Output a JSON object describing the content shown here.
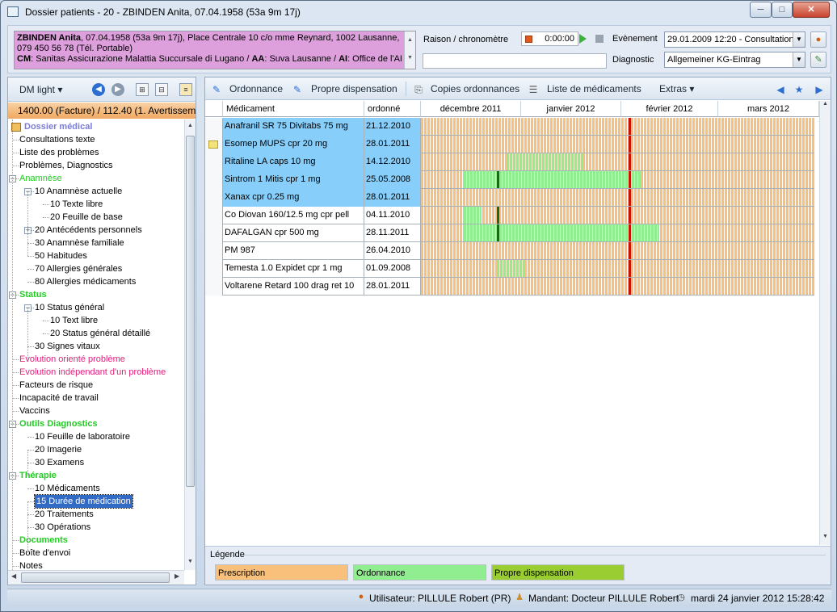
{
  "window": {
    "title": "Dossier patients - 20 - ZBINDEN Anita, 07.04.1958 (53a 9m 17j)",
    "min_glyph": "─",
    "max_glyph": "□",
    "close_glyph": "✕"
  },
  "patient": {
    "name": "ZBINDEN Anita",
    "details": ", 07.04.1958 (53a 9m 17j), Place Centrale 10 c/o mme Reynard, 1002 Lausanne, 079 450 56 78 (Tél. Portable)",
    "cm_label": "CM",
    "cm_value": ": Sanitas Assicurazione Malattia Succursale di Lugano / ",
    "aa_label": "AA",
    "aa_value": ": Suva Lausanne / ",
    "ai_label": "AI",
    "ai_value": ": Office de l'AI"
  },
  "header": {
    "raison_label": "Raison / chronomètre",
    "chrono_value": "0:00:00",
    "evenement_label": "Evènement",
    "evenement_value": "29.01.2009 12:20 - Consultation",
    "diagnostic_label": "Diagnostic",
    "diagnostic_value": "Allgemeiner KG-Eintrag"
  },
  "left_toolbar": {
    "dm_light": "DM light"
  },
  "factura": "1400.00 (Facture) / 112.40 (1. Avertissement)",
  "tree": [
    {
      "label": "Dossier médical",
      "level": 0,
      "color": "#7b7bd8",
      "bold": true,
      "icon": "book-icon"
    },
    {
      "label": "Consultations texte",
      "level": 0,
      "color": "#000"
    },
    {
      "label": "Liste des problèmes",
      "level": 0,
      "color": "#000"
    },
    {
      "label": "Problèmes, Diagnostics",
      "level": 0,
      "color": "#000"
    },
    {
      "label": "Anamnèse",
      "level": 0,
      "color": "#22cc22",
      "expander": "-"
    },
    {
      "label": "10 Anamnèse actuelle",
      "level": 1,
      "color": "#000",
      "expander": "-"
    },
    {
      "label": "10 Texte libre",
      "level": 2,
      "color": "#000"
    },
    {
      "label": "20 Feuille de base",
      "level": 2,
      "color": "#000"
    },
    {
      "label": "20 Antécédents personnels",
      "level": 1,
      "color": "#000",
      "expander": "+"
    },
    {
      "label": "30 Anamnèse familiale",
      "level": 1,
      "color": "#000"
    },
    {
      "label": "50 Habitudes",
      "level": 1,
      "color": "#000"
    },
    {
      "label": "70 Allergies générales",
      "level": 1,
      "color": "#000"
    },
    {
      "label": "80 Allergies médicaments",
      "level": 1,
      "color": "#000"
    },
    {
      "label": "Status",
      "level": 0,
      "color": "#22cc22",
      "bold": true,
      "expander": "-"
    },
    {
      "label": "10 Status général",
      "level": 1,
      "color": "#000",
      "expander": "-"
    },
    {
      "label": "10 Text libre",
      "level": 2,
      "color": "#000"
    },
    {
      "label": "20 Status général détaillé",
      "level": 2,
      "color": "#000"
    },
    {
      "label": "30 Signes vitaux",
      "level": 1,
      "color": "#000"
    },
    {
      "label": "Evolution orienté problème",
      "level": 0,
      "color": "#e0207a"
    },
    {
      "label": "Evolution indépendant d'un problème",
      "level": 0,
      "color": "#e0207a"
    },
    {
      "label": "Facteurs de risque",
      "level": 0,
      "color": "#000"
    },
    {
      "label": "Incapacité de travail",
      "level": 0,
      "color": "#000"
    },
    {
      "label": "Vaccins",
      "level": 0,
      "color": "#000"
    },
    {
      "label": "Outils Diagnostics",
      "level": 0,
      "color": "#22cc22",
      "bold": true,
      "expander": "-"
    },
    {
      "label": "10 Feuille de laboratoire",
      "level": 1,
      "color": "#000"
    },
    {
      "label": "20 Imagerie",
      "level": 1,
      "color": "#000"
    },
    {
      "label": "30 Examens",
      "level": 1,
      "color": "#000"
    },
    {
      "label": "Thérapie",
      "level": 0,
      "color": "#22cc22",
      "bold": true,
      "expander": "-"
    },
    {
      "label": "10 Médicaments",
      "level": 1,
      "color": "#000"
    },
    {
      "label": "15 Durée de médication",
      "level": 1,
      "color": "#000",
      "selected": true
    },
    {
      "label": "20 Traitements",
      "level": 1,
      "color": "#000"
    },
    {
      "label": "30 Opérations",
      "level": 1,
      "color": "#000"
    },
    {
      "label": "Documents",
      "level": 0,
      "color": "#22cc22",
      "bold": true
    },
    {
      "label": "Boîte d'envoi",
      "level": 0,
      "color": "#000"
    },
    {
      "label": "Notes",
      "level": 0,
      "color": "#000"
    }
  ],
  "toolbar": {
    "ordonnance": "Ordonnance",
    "propre": "Propre dispensation",
    "copies": "Copies ordonnances",
    "liste": "Liste de médicaments",
    "extras": "Extras"
  },
  "grid": {
    "col_med": "Médicament",
    "col_date": "ordonné",
    "months": [
      "décembre 2011",
      "janvier 2012",
      "février 2012",
      "mars 2012"
    ]
  },
  "colors": {
    "prescription": "#f8c07a",
    "ordonnance": "#90ee90",
    "propre": "#9acd32",
    "selected_row": "#87cefa",
    "today_line": "#cc1100"
  },
  "medications": [
    {
      "name": "Anafranil SR 75 Divitabs 75 mg",
      "date": "21.12.2010",
      "selected": true,
      "note": false,
      "ordonnance": null
    },
    {
      "name": "Esomep MUPS cpr 20 mg",
      "date": "28.01.2011",
      "selected": true,
      "note": true,
      "ordonnance": null
    },
    {
      "name": "Ritaline LA caps 10 mg",
      "date": "14.12.2010",
      "selected": true,
      "note": false,
      "ordonnance": [
        "2011-12-15",
        "2012-01-09"
      ]
    },
    {
      "name": "Sintrom 1 Mitis cpr 1 mg",
      "date": "25.05.2008",
      "selected": true,
      "note": false,
      "ordonnance": [
        "2011-12-01",
        "2012-01-28"
      ]
    },
    {
      "name": "Xanax cpr 0.25 mg",
      "date": "28.01.2011",
      "selected": true,
      "note": false,
      "ordonnance": null
    },
    {
      "name": "Co Diovan 160/12.5 mg cpr pell",
      "date": "04.11.2010",
      "selected": false,
      "note": false,
      "ordonnance": [
        "2011-12-01",
        "2011-12-07"
      ]
    },
    {
      "name": "DAFALGAN cpr 500 mg",
      "date": "28.11.2011",
      "selected": false,
      "note": false,
      "ordonnance": [
        "2011-12-01",
        "2012-02-03"
      ]
    },
    {
      "name": "PM 987",
      "date": "26.04.2010",
      "selected": false,
      "note": false,
      "ordonnance": null
    },
    {
      "name": "Temesta 1.0 Expidet cpr 1 mg",
      "date": "01.09.2008",
      "selected": false,
      "note": false,
      "ordonnance": [
        "2011-12-12",
        "2011-12-21"
      ]
    },
    {
      "name": "Voltarene Retard 100 drag ret 10",
      "date": "28.01.2011",
      "selected": false,
      "note": false,
      "ordonnance": null
    }
  ],
  "legend": {
    "title": "Légende",
    "prescription": "Prescription",
    "ordonnance": "Ordonnance",
    "propre": "Propre dispensation"
  },
  "status": {
    "user": "Utilisateur: PILLULE Robert   (PR)",
    "mandant": "Mandant: Docteur PILLULE Robert",
    "datetime": "mardi 24 janvier 2012 15:28:42"
  }
}
